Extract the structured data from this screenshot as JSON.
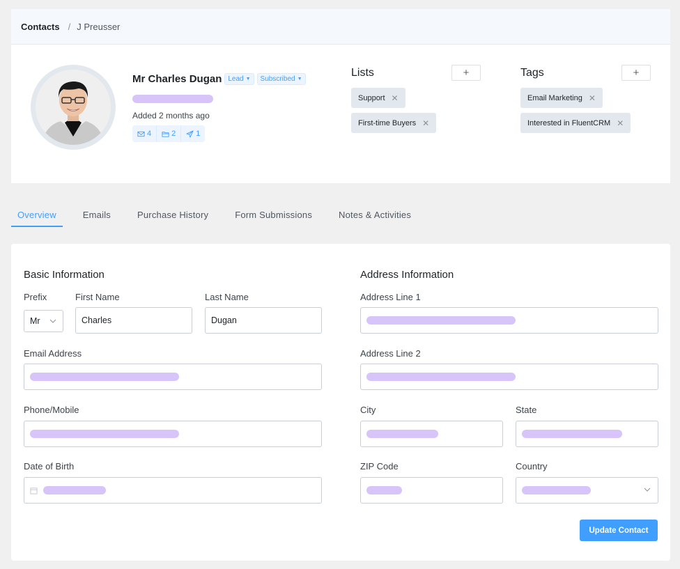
{
  "breadcrumb": {
    "root": "Contacts",
    "separator": "/",
    "current": "J Preusser"
  },
  "profile": {
    "name": "Mr Charles Dugan",
    "status_dropdown": "Lead",
    "subscription_dropdown": "Subscribed",
    "email": "",
    "added": "Added 2 months ago",
    "stats": {
      "emails": "4",
      "purchases": "2",
      "forms": "1"
    }
  },
  "lists": {
    "title": "Lists",
    "add": "+",
    "items": [
      "Support",
      "First-time Buyers"
    ]
  },
  "tags": {
    "title": "Tags",
    "add": "+",
    "items": [
      "Email Marketing",
      "Interested in FluentCRM"
    ]
  },
  "tabs": [
    "Overview",
    "Emails",
    "Purchase History",
    "Form Submissions",
    "Notes & Activities"
  ],
  "active_tab": "Overview",
  "basic": {
    "title": "Basic Information",
    "prefix_label": "Prefix",
    "prefix_value": "Mr",
    "first_name_label": "First Name",
    "first_name_value": "Charles",
    "last_name_label": "Last Name",
    "last_name_value": "Dugan",
    "email_label": "Email Address",
    "phone_label": "Phone/Mobile",
    "dob_label": "Date of Birth"
  },
  "address": {
    "title": "Address Information",
    "line1_label": "Address Line 1",
    "line2_label": "Address Line 2",
    "city_label": "City",
    "state_label": "State",
    "zip_label": "ZIP Code",
    "country_label": "Country"
  },
  "update_button": "Update Contact",
  "colors": {
    "accent": "#409eff",
    "redacted": "#d7c5fa",
    "chip_bg": "#e3e8ee"
  }
}
